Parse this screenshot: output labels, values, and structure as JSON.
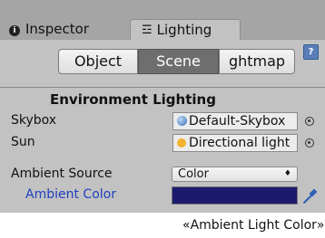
{
  "tabs": {
    "inspector_label": "Inspector",
    "lighting_label": "Lighting",
    "info_glyph": "i",
    "lighting_icon": "☲"
  },
  "toolbar": {
    "buttons": [
      "Object",
      "Scene",
      "ghtmap"
    ],
    "selected": "Scene",
    "help_glyph": "?"
  },
  "environment": {
    "section_title": "Environment Lighting",
    "skybox": {
      "label": "Skybox",
      "value": "Default-Skybox"
    },
    "sun": {
      "label": "Sun",
      "value": "Directional light"
    },
    "ambient_source": {
      "label": "Ambient Source",
      "value": "Color",
      "arrows": "♦"
    },
    "ambient_color": {
      "label": "Ambient Color",
      "value": "#1c1a6e",
      "label_color": "#2040c0"
    }
  },
  "caption": "«Ambient Light Color»",
  "colors": {
    "panel_bg": "#c2c2c2",
    "tabstrip_bg": "#a5a5a5",
    "selected_segment": "#6e6e6e",
    "eyedropper": "#2b5fb8"
  }
}
